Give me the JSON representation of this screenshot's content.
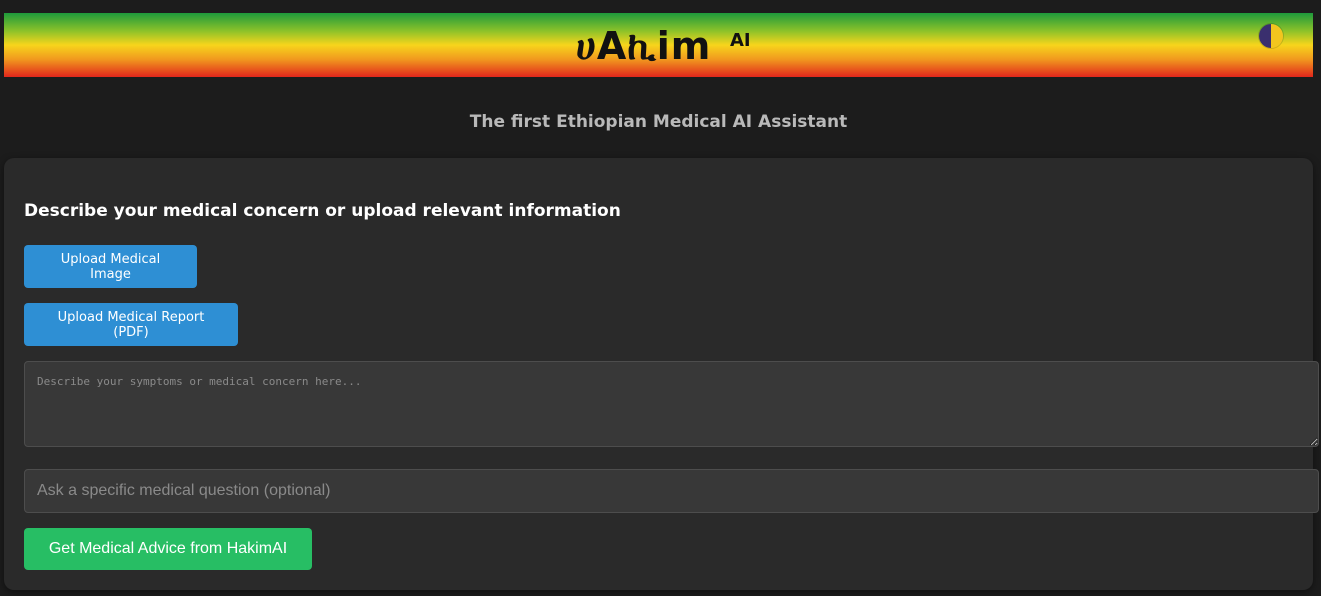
{
  "header": {
    "brand_name": "ሀAኪim",
    "brand_suffix": "AI",
    "theme_toggle_icon": "half-moon-theme-icon",
    "gradient_colors": [
      "#1e9a3c",
      "#f7d51c",
      "#e1261c"
    ]
  },
  "tagline": "The first Ethiopian Medical AI Assistant",
  "form": {
    "title": "Describe your medical concern or upload relevant information",
    "upload_image_label": "Upload Medical Image",
    "upload_report_label": "Upload Medical Report (PDF)",
    "symptoms_placeholder": "Describe your symptoms or medical concern here...",
    "symptoms_value": "",
    "question_placeholder": "Ask a specific medical question (optional)",
    "question_value": "",
    "submit_label": "Get Medical Advice from HakimAI"
  },
  "colors": {
    "accent_blue": "#2e8fd4",
    "accent_green": "#27be64",
    "background": "#1c1c1c",
    "panel": "#2a2a2a"
  }
}
